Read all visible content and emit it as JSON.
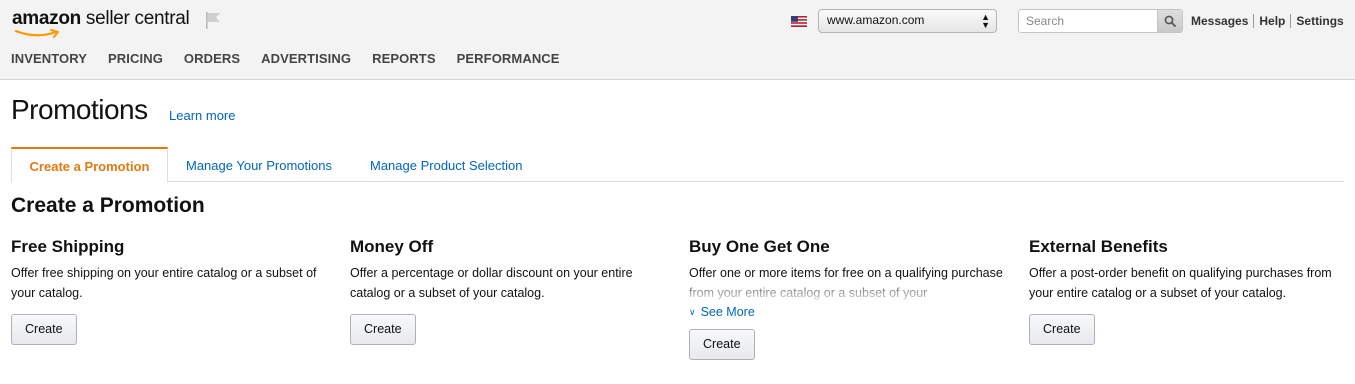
{
  "header": {
    "logo_brand": "amazon",
    "logo_product": " seller central",
    "marketplace_selected": "www.amazon.com",
    "search_placeholder": "Search",
    "links": {
      "messages": "Messages",
      "help": "Help",
      "settings": "Settings"
    }
  },
  "nav": [
    "INVENTORY",
    "PRICING",
    "ORDERS",
    "ADVERTISING",
    "REPORTS",
    "PERFORMANCE"
  ],
  "page": {
    "title": "Promotions",
    "learn_more": "Learn more"
  },
  "tabs": [
    {
      "label": "Create a Promotion",
      "active": true
    },
    {
      "label": "Manage Your Promotions",
      "active": false
    },
    {
      "label": "Manage Product Selection",
      "active": false
    }
  ],
  "section_title": "Create a Promotion",
  "cards": [
    {
      "title": "Free Shipping",
      "description": "Offer free shipping on your entire catalog or a subset of your catalog.",
      "button": "Create"
    },
    {
      "title": "Money Off",
      "description": "Offer a percentage or dollar discount on your entire catalog or a subset of your catalog.",
      "button": "Create"
    },
    {
      "title": "Buy One Get One",
      "description": "Offer one or more items for free on a qualifying purchase from your entire catalog or a subset of your",
      "see_more": "See More",
      "button": "Create"
    },
    {
      "title": "External Benefits",
      "description": "Offer a post-order benefit on qualifying purchases from your entire catalog or a subset of your catalog.",
      "button": "Create"
    }
  ],
  "colors": {
    "accent": "#e47911",
    "link": "#0066c0",
    "header_bg": "#f3f3f3"
  },
  "icons": {
    "flag": "flag-icon",
    "us_flag": "us-flag-icon",
    "search": "search-icon",
    "select_arrows": "select-arrows-icon",
    "see_more_chevron": "chevron-down-icon"
  }
}
